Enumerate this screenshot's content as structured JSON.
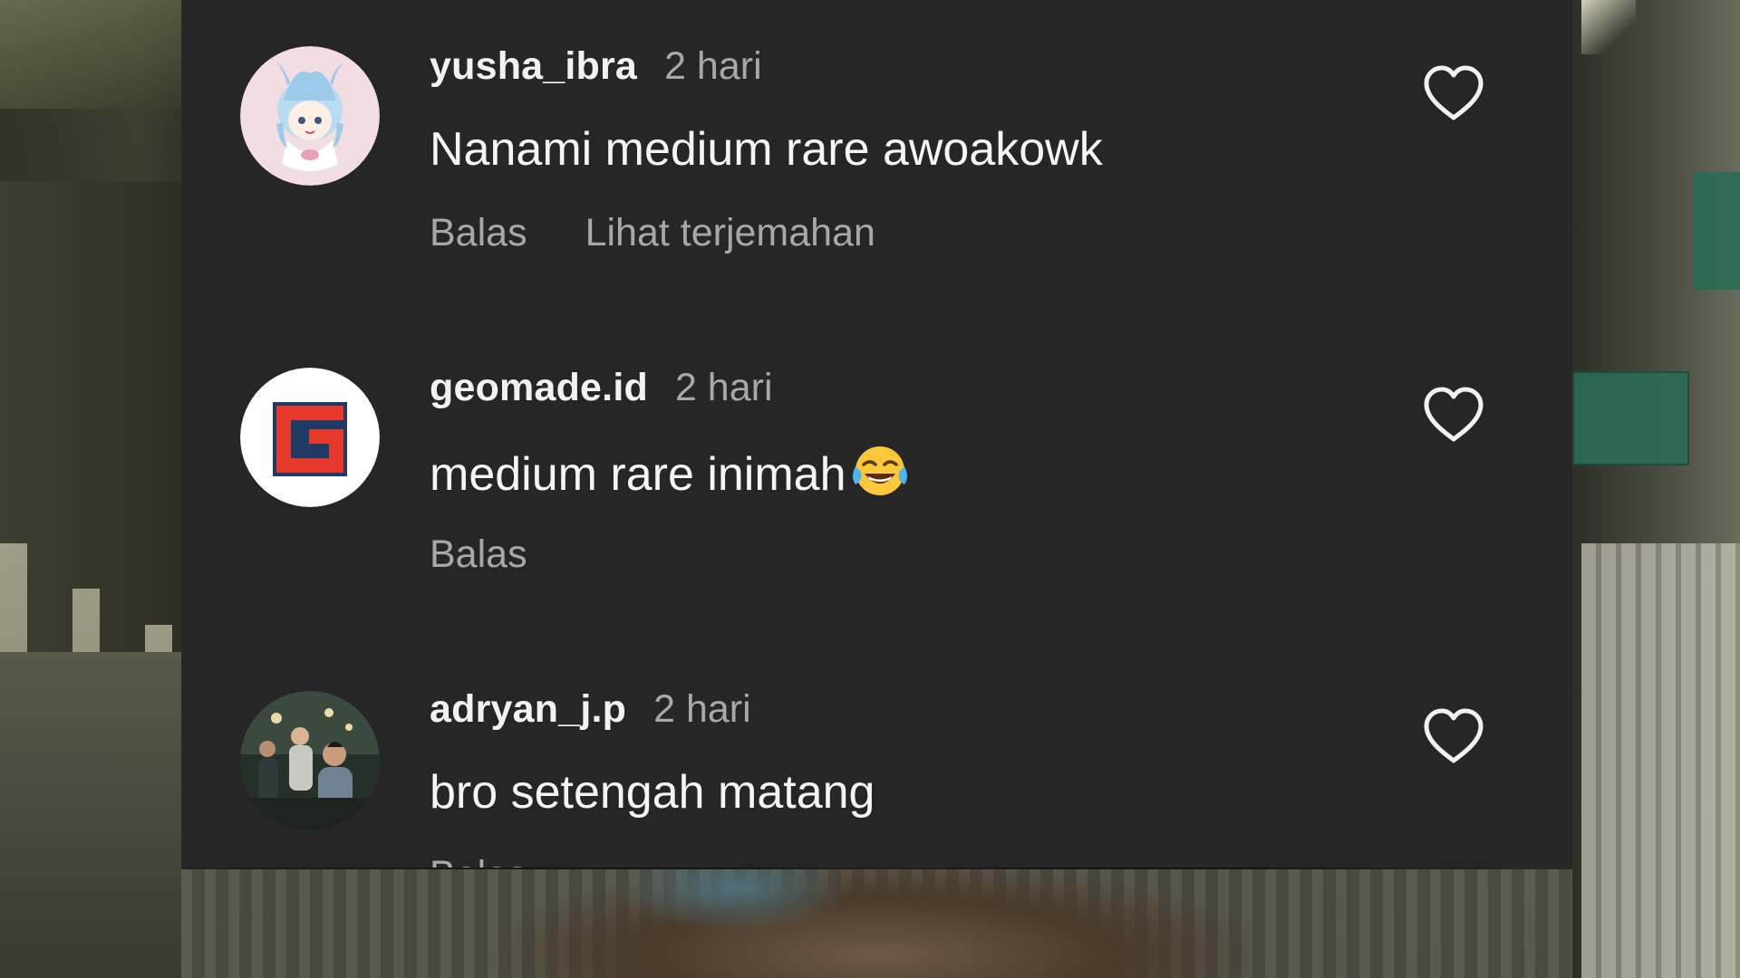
{
  "comments": [
    {
      "username": "yusha_ibra",
      "time": "2 hari",
      "text": "Nanami medium rare awoakowk",
      "avatar_icon": "anime-girl-avatar-icon",
      "actions": [
        "Balas",
        "Lihat terjemahan"
      ]
    },
    {
      "username": "geomade.id",
      "time": "2 hari",
      "text": "medium rare inimah",
      "emoji": "face-with-tears-of-joy-icon",
      "avatar_icon": "geomade-logo-icon",
      "actions": [
        "Balas"
      ]
    },
    {
      "username": "adryan_j.p",
      "time": "2 hari",
      "text": "bro setengah matang",
      "avatar_icon": "photo-avatar-icon",
      "actions": [
        "Balas"
      ]
    }
  ],
  "colors": {
    "panel_background": "#262626",
    "username": "#f2f2f2",
    "secondary_text": "#a8a8a8",
    "logo_red": "#e53a2b",
    "logo_navy": "#1f3b63"
  },
  "like_icon": "heart-outline-icon"
}
